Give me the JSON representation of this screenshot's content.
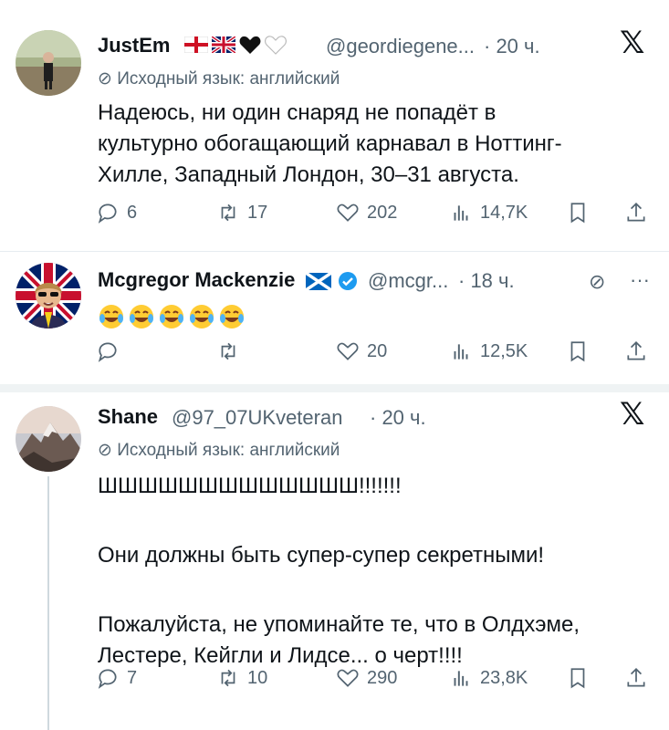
{
  "tweets": [
    {
      "name": "JustEm",
      "handle": "@geordiegene...",
      "time": "· 20 ч.",
      "translated": "Исходный язык: английский",
      "text_lines": [
        "Надеюсь, ни один снаряд не попадёт в",
        "культурно обогащающий карнавал в Ноттинг-",
        "Хилле, Западный Лондон, 30–31 августа."
      ],
      "replies": "6",
      "retweets": "17",
      "likes": "202",
      "views": "14,7K"
    },
    {
      "name": "Mcgregor Mackenzie",
      "handle": "@mcgr...",
      "time": "· 18 ч.",
      "text_lines": [],
      "emoji_count": 5,
      "replies": "",
      "retweets": "",
      "likes": "20",
      "views": "12,5K",
      "more": "···"
    },
    {
      "name": "Shane",
      "handle": "@97_07UKveteran",
      "time": "· 20 ч.",
      "translated": "Исходный язык: английский",
      "text_lines": [
        "ШШШШШШШШШШШШШ!!!!!!!",
        "",
        "Они должны быть супер-супер секретными!",
        "",
        "Пожалуйста, не упоминайте те, что в Олдхэме,",
        "Лестере, Кейгли и Лидсе... о черт!!!!"
      ],
      "replies": "7",
      "retweets": "10",
      "likes": "290",
      "views": "23,8K"
    }
  ],
  "colors": {
    "verified": "#1d9bf0",
    "text_secondary": "#536471"
  }
}
